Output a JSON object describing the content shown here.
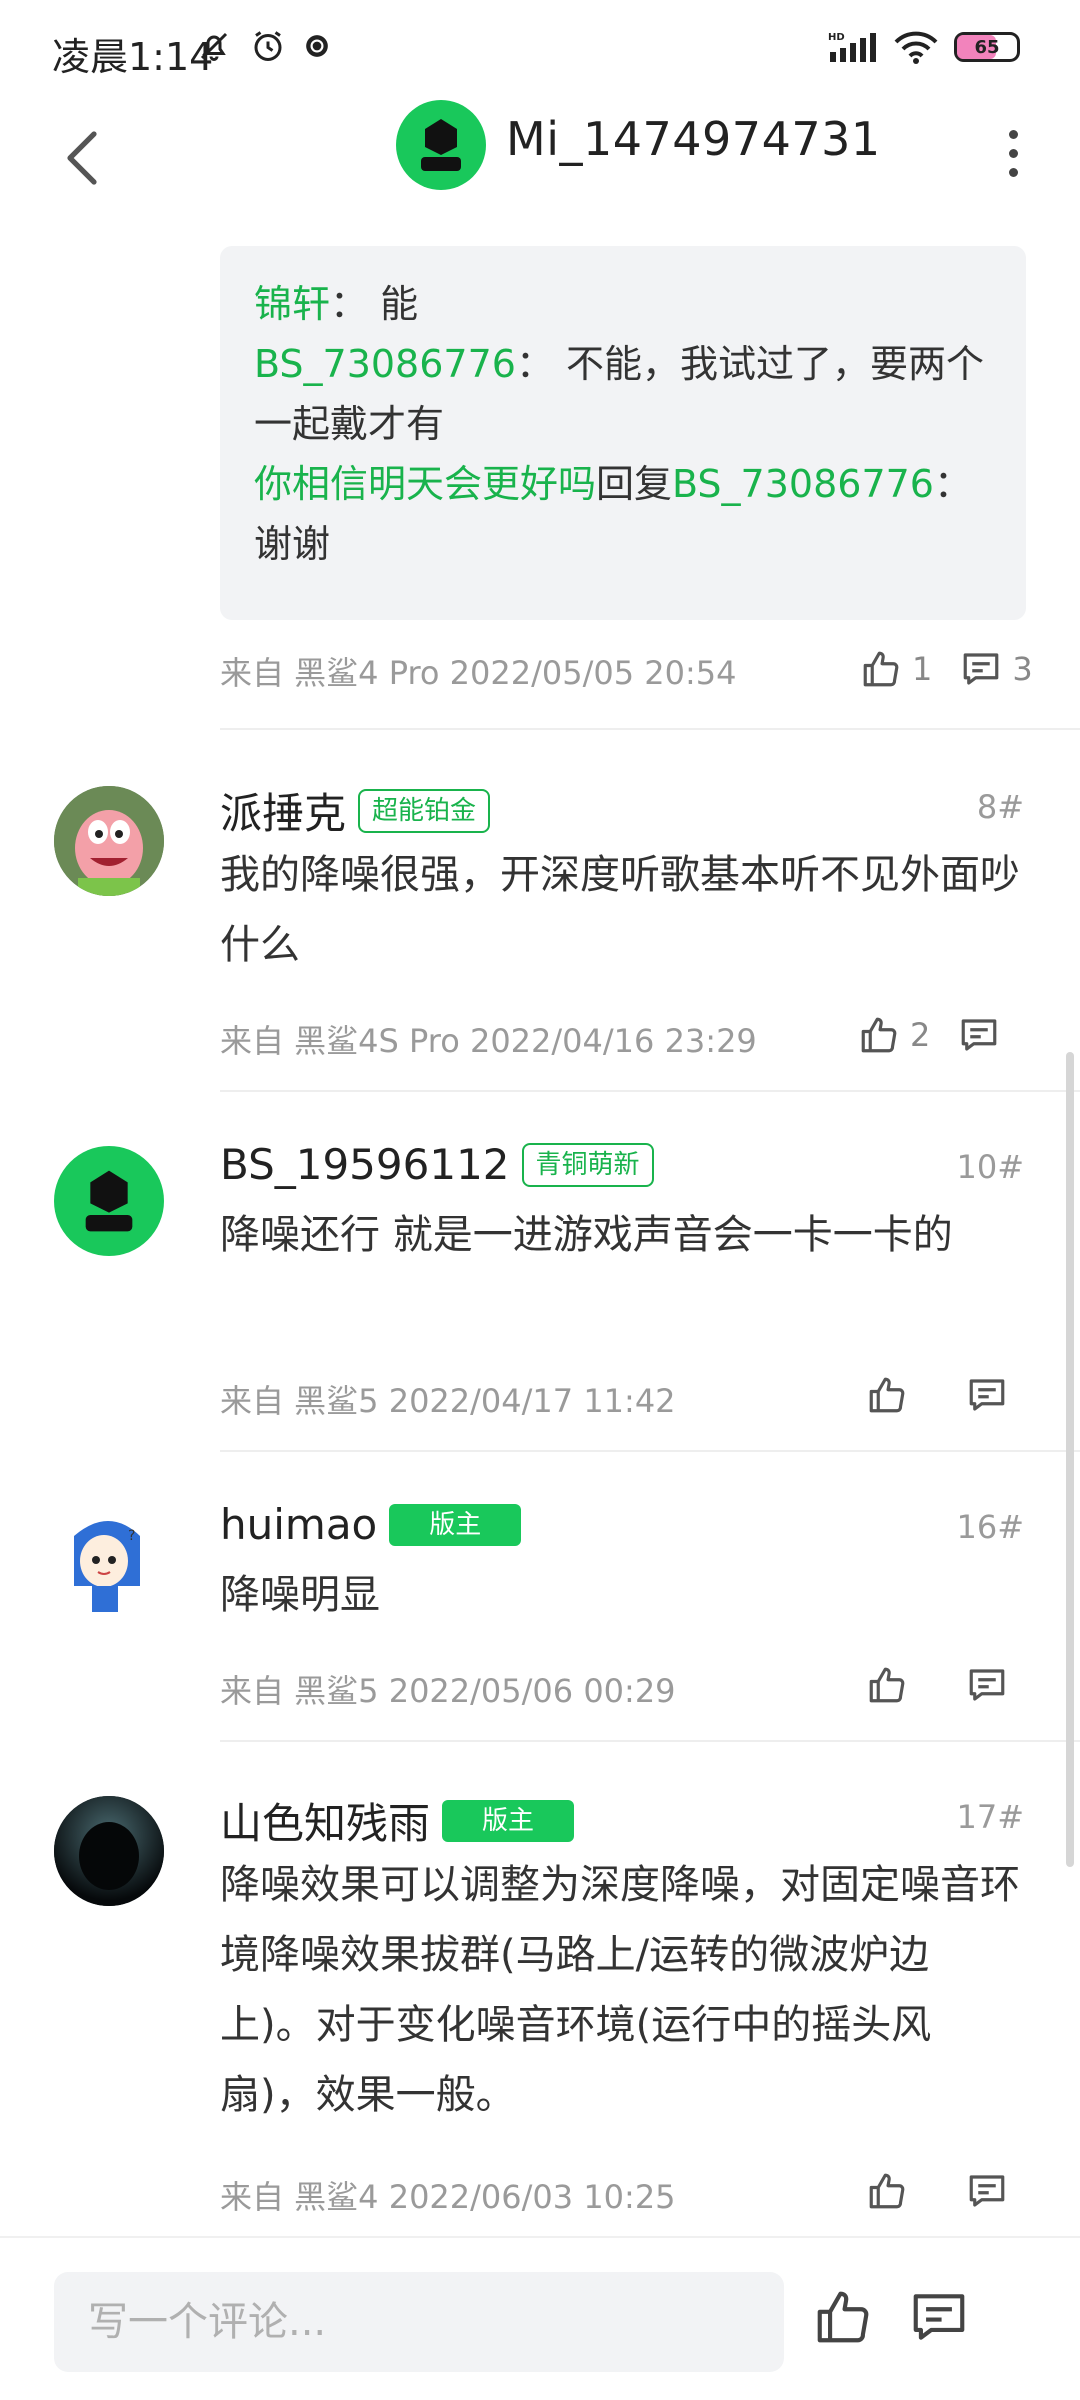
{
  "status_bar": {
    "time": "凌晨1:14",
    "battery": "65"
  },
  "header": {
    "title": "Mi_1474974731"
  },
  "reply_block": {
    "lines": [
      {
        "user": "锦轩",
        "sep": "：",
        "text": "能"
      },
      {
        "user": "BS_73086776",
        "sep": "：",
        "text": "不能，我试过了，要两个一起戴才有"
      },
      {
        "user": "你相信明天会更好吗",
        "reply_word": "回复",
        "target": "BS_73086776",
        "sep": "：",
        "text": "谢谢"
      }
    ],
    "meta": "来自 黑鲨4 Pro  2022/05/05 20:54",
    "likes": "1",
    "comments": "3"
  },
  "comments": [
    {
      "name": "派捶克",
      "badge": "超能铂金",
      "floor": "8#",
      "text": "我的降噪很强，开深度听歌基本听不见外面吵什么",
      "meta": "来自 黑鲨4S Pro  2022/04/16 23:29",
      "likes": "2"
    },
    {
      "name": "BS_19596112",
      "badge": "青铜萌新",
      "floor": "10#",
      "text": "降噪还行 就是一进游戏声音会一卡一卡的",
      "meta": "来自 黑鲨5  2022/04/17 11:42",
      "likes": ""
    },
    {
      "name": "huimao",
      "badge": "版主",
      "floor": "16#",
      "text": "降噪明显",
      "meta": "来自 黑鲨5  2022/05/06 00:29",
      "likes": ""
    },
    {
      "name": "山色知残雨",
      "badge": "版主",
      "floor": "17#",
      "text": "降噪效果可以调整为深度降噪，对固定噪音环境降噪效果拔群(马路上/运转的微波炉边上)。对于变化噪音环境(运行中的摇头风扇)，效果一般。",
      "meta": "来自 黑鲨4  2022/06/03 10:25",
      "likes": ""
    }
  ],
  "bottom_bar": {
    "placeholder": "写一个评论..."
  },
  "colors": {
    "accent": "#19b34c",
    "avatar_green": "#19c85b"
  }
}
